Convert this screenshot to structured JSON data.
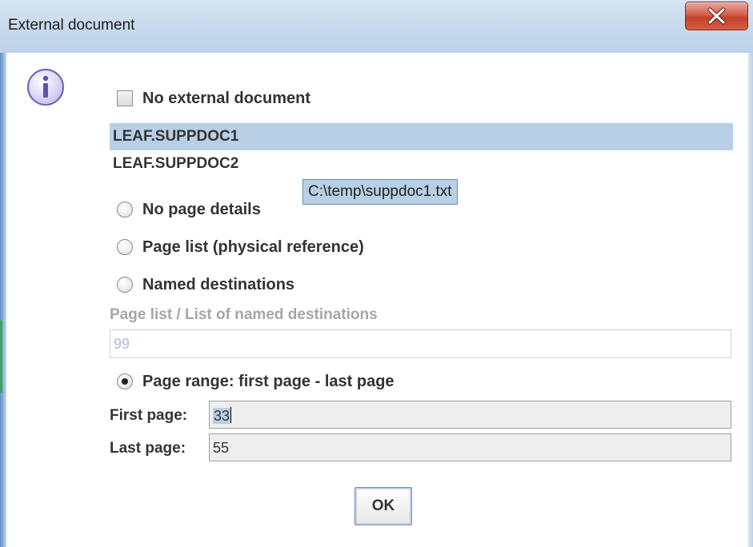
{
  "window": {
    "title": "External document",
    "close_icon": "close-x-icon"
  },
  "info_icon": "info-icon",
  "no_external_checkbox": {
    "label": "No external document",
    "checked": false
  },
  "documents": [
    {
      "label": "LEAF.SUPPDOC1",
      "selected": true
    },
    {
      "label": "LEAF.SUPPDOC2",
      "selected": false
    }
  ],
  "tooltip": "C:\\temp\\suppdoc1.txt",
  "radios": [
    {
      "label": "No page details",
      "checked": false
    },
    {
      "label": "Page list (physical reference)",
      "checked": false
    },
    {
      "label": "Named destinations",
      "checked": false
    }
  ],
  "page_list": {
    "label": "Page list / List of named destinations",
    "value": "99",
    "enabled": false
  },
  "page_range_radio": {
    "label": "Page range: first page - last page",
    "checked": true
  },
  "first_page": {
    "label": "First page:",
    "value": "33"
  },
  "last_page": {
    "label": "Last page:",
    "value": "55"
  },
  "ok_button": "OK",
  "colors": {
    "selection": "#b8cfe5",
    "text": "#333333",
    "disabled_text": "#a6a6a6",
    "close_button": "#c2412a"
  }
}
